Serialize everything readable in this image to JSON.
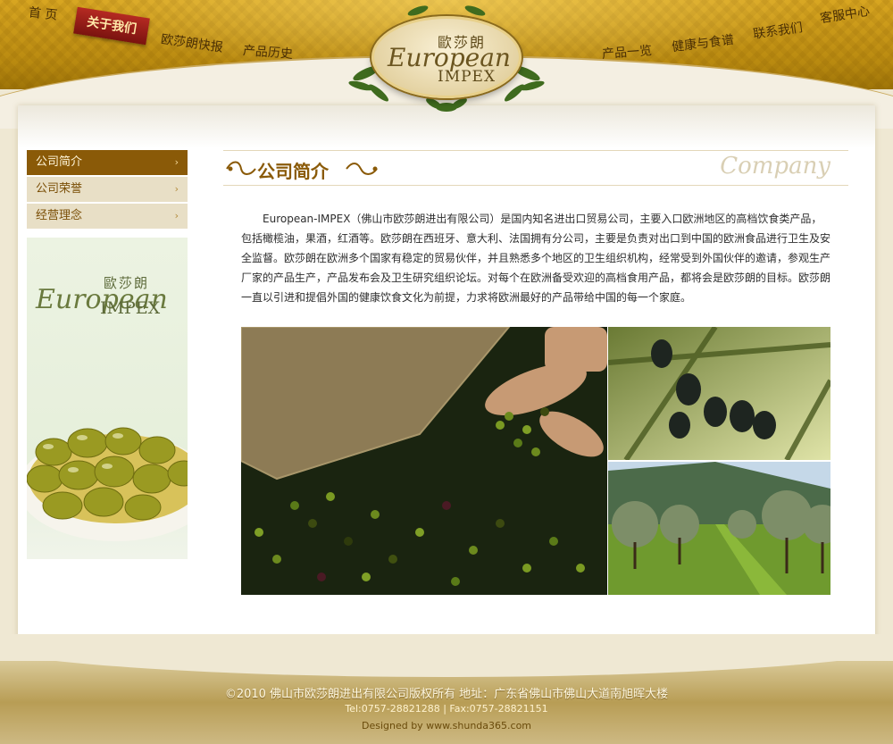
{
  "nav": {
    "left": [
      "首 页",
      "关于我们",
      "欧莎朗快报",
      "产品历史"
    ],
    "right": [
      "产品一览",
      "健康与食谱",
      "联系我们",
      "客服中心"
    ]
  },
  "logo": {
    "cn": "歐莎朗",
    "en": "European",
    "impex": "IMPEX"
  },
  "sidebar": {
    "items": [
      {
        "label": "公司简介",
        "icon": "chevron-right-icon"
      },
      {
        "label": "公司荣誉",
        "icon": "chevron-right-icon"
      },
      {
        "label": "经营理念",
        "icon": "chevron-right-icon"
      }
    ],
    "banner": {
      "cn": "歐莎朗",
      "en": "European",
      "impex": "IMPEX"
    }
  },
  "main": {
    "title": "公司简介",
    "title_en": "Company",
    "intro": "European-IMPEX（佛山市欧莎朗进出有限公司）是国内知名进出口贸易公司，主要入口欧洲地区的高档饮食类产品，包括橄榄油，果酒，红酒等。欧莎朗在西班牙、意大利、法国拥有分公司，主要是负责对出口到中国的欧洲食品进行卫生及安全监督。欧莎朗在欧洲多个国家有稳定的贸易伙伴，并且熟悉多个地区的卫生组织机构，经常受到外国伙伴的邀请，参观生产厂家的产品生产，产品发布会及卫生研究组织论坛。对每个在欧洲备受欢迎的高档食用产品，都将会是欧莎朗的目标。欧莎朗一直以引进和提倡外国的健康饮食文化为前提，力求将欧洲最好的产品带给中国的每一个家庭。"
  },
  "footer": {
    "copyright": "©2010 佛山市欧莎朗进出有限公司版权所有   地址：广东省佛山市佛山大道南旭晖大楼",
    "contact": "Tel:0757-28821288 | Fax:0757-28821151",
    "designed": "Designed by www.shunda365.com"
  },
  "colors": {
    "brand_brown": "#8a5a08",
    "gold": "#c79a1a",
    "active_red": "#9c1f18"
  }
}
